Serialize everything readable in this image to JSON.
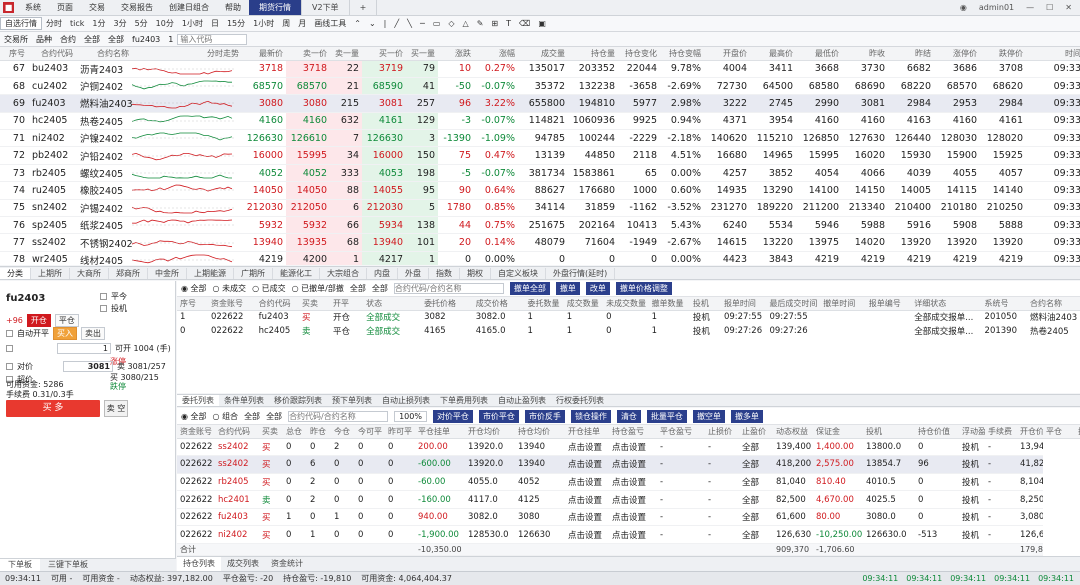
{
  "titlebar": {
    "menus": [
      "系统",
      "页面",
      "交易",
      "交易报告",
      "创建日组合",
      "帮助"
    ],
    "tabs": [
      "期货行情",
      "V2下单"
    ],
    "active_tab": "期货行情",
    "user": "admin01",
    "add_tab": "+"
  },
  "toolbar": {
    "items": [
      "自选行情",
      "分时",
      "tick",
      "1分",
      "3分",
      "5分",
      "10分",
      "1小时",
      "日",
      "15分",
      "1小时",
      "周",
      "月",
      "画线工具"
    ],
    "tools": [
      "⌃",
      "⌄",
      "|",
      "╱",
      "╲",
      "─",
      "▭",
      "◇",
      "△",
      "✎",
      "⊞",
      "T",
      "⌫",
      "▣"
    ]
  },
  "filterbar": {
    "items": [
      "交易所",
      "品种",
      "合约",
      "全部",
      "全部",
      "fu2403"
    ],
    "pager": "1",
    "search_placeholder": "输入代码"
  },
  "quotes": {
    "headers": [
      "序号",
      "合约代码",
      "合约名称",
      "分时走势",
      "最新价",
      "卖一价",
      "卖一量",
      "买一价",
      "买一量",
      "涨跌",
      "涨幅",
      "成交量",
      "持仓量",
      "持仓变化",
      "持仓变幅",
      "开盘价",
      "最高价",
      "最低价",
      "昨收",
      "昨结",
      "涨停价",
      "跌停价",
      "时间"
    ],
    "rows": [
      {
        "no": "67",
        "code": "bu2403",
        "name": "沥青2403",
        "last": "3718",
        "ask": "3718",
        "askv": "22",
        "bid": "3719",
        "bidv": "79",
        "chg": "10",
        "pct": "0.27%",
        "vol": "135017",
        "oi": "203352",
        "oichg": "22044",
        "oipct": "9.78%",
        "c1": "4004",
        "c2": "3411",
        "c3": "3668",
        "c4": "3730",
        "c5": "6682",
        "c6": "3686",
        "c7": "3708",
        "time": "09:33",
        "dir": "up"
      },
      {
        "no": "68",
        "code": "cu2402",
        "name": "沪铜2402",
        "last": "68570",
        "ask": "68570",
        "askv": "21",
        "bid": "68590",
        "bidv": "41",
        "chg": "-50",
        "pct": "-0.07%",
        "vol": "35372",
        "oi": "132238",
        "oichg": "-3658",
        "oipct": "-2.69%",
        "c1": "72730",
        "c2": "64500",
        "c3": "68580",
        "c4": "68690",
        "c5": "68220",
        "c6": "68570",
        "c7": "68620",
        "time": "09:33",
        "dir": "dn"
      },
      {
        "no": "69",
        "code": "fu2403",
        "name": "燃料油2403",
        "last": "3080",
        "ask": "3080",
        "askv": "215",
        "bid": "3081",
        "bidv": "257",
        "chg": "96",
        "pct": "3.22%",
        "vol": "655800",
        "oi": "194810",
        "oichg": "5977",
        "oipct": "2.98%",
        "c1": "3222",
        "c2": "2745",
        "c3": "2990",
        "c4": "3081",
        "c5": "2984",
        "c6": "2953",
        "c7": "2984",
        "time": "09:33",
        "dir": "up"
      },
      {
        "no": "70",
        "code": "hc2405",
        "name": "热卷2405",
        "last": "4160",
        "ask": "4160",
        "askv": "632",
        "bid": "4161",
        "bidv": "129",
        "chg": "-3",
        "pct": "-0.07%",
        "vol": "114821",
        "oi": "1060936",
        "oichg": "9925",
        "oipct": "0.94%",
        "c1": "4371",
        "c2": "3954",
        "c3": "4160",
        "c4": "4160",
        "c5": "4163",
        "c6": "4160",
        "c7": "4161",
        "time": "09:33",
        "dir": "dn"
      },
      {
        "no": "71",
        "code": "ni2402",
        "name": "沪镍2402",
        "last": "126630",
        "ask": "126610",
        "askv": "7",
        "bid": "126630",
        "bidv": "3",
        "chg": "-1390",
        "pct": "-1.09%",
        "vol": "94785",
        "oi": "100244",
        "oichg": "-2229",
        "oipct": "-2.18%",
        "c1": "140620",
        "c2": "115210",
        "c3": "126850",
        "c4": "127630",
        "c5": "126440",
        "c6": "128030",
        "c7": "128020",
        "time": "09:33",
        "dir": "dn"
      },
      {
        "no": "72",
        "code": "pb2402",
        "name": "沪铅2402",
        "last": "16000",
        "ask": "15995",
        "askv": "34",
        "bid": "16000",
        "bidv": "150",
        "chg": "75",
        "pct": "0.47%",
        "vol": "13139",
        "oi": "44850",
        "oichg": "2118",
        "oipct": "4.51%",
        "c1": "16680",
        "c2": "14965",
        "c3": "15995",
        "c4": "16020",
        "c5": "15930",
        "c6": "15900",
        "c7": "15925",
        "time": "09:33",
        "dir": "up"
      },
      {
        "no": "73",
        "code": "rb2405",
        "name": "螺纹2405",
        "last": "4052",
        "ask": "4052",
        "askv": "333",
        "bid": "4053",
        "bidv": "198",
        "chg": "-5",
        "pct": "-0.07%",
        "vol": "381734",
        "oi": "1583861",
        "oichg": "65",
        "oipct": "0.00%",
        "c1": "4257",
        "c2": "3852",
        "c3": "4054",
        "c4": "4066",
        "c5": "4039",
        "c6": "4055",
        "c7": "4057",
        "time": "09:33",
        "dir": "dn"
      },
      {
        "no": "74",
        "code": "ru2405",
        "name": "橡胶2405",
        "last": "14050",
        "ask": "14050",
        "askv": "88",
        "bid": "14055",
        "bidv": "95",
        "chg": "90",
        "pct": "0.64%",
        "vol": "88627",
        "oi": "176680",
        "oichg": "1000",
        "oipct": "0.60%",
        "c1": "14935",
        "c2": "13290",
        "c3": "14100",
        "c4": "14150",
        "c5": "14005",
        "c6": "14115",
        "c7": "14140",
        "time": "09:33",
        "dir": "up"
      },
      {
        "no": "75",
        "code": "sn2402",
        "name": "沪锡2402",
        "last": "212030",
        "ask": "212050",
        "askv": "6",
        "bid": "212030",
        "bidv": "5",
        "chg": "1780",
        "pct": "0.85%",
        "vol": "34114",
        "oi": "31859",
        "oichg": "-1162",
        "oipct": "-3.52%",
        "c1": "231270",
        "c2": "189220",
        "c3": "211200",
        "c4": "213340",
        "c5": "210400",
        "c6": "210180",
        "c7": "210250",
        "time": "09:33",
        "dir": "up"
      },
      {
        "no": "76",
        "code": "sp2405",
        "name": "纸浆2405",
        "last": "5932",
        "ask": "5932",
        "askv": "66",
        "bid": "5934",
        "bidv": "138",
        "chg": "44",
        "pct": "0.75%",
        "vol": "251675",
        "oi": "202164",
        "oichg": "10413",
        "oipct": "5.43%",
        "c1": "6240",
        "c2": "5534",
        "c3": "5946",
        "c4": "5988",
        "c5": "5916",
        "c6": "5908",
        "c7": "5888",
        "time": "09:33",
        "dir": "up"
      },
      {
        "no": "77",
        "code": "ss2402",
        "name": "不锈钢2402",
        "last": "13940",
        "ask": "13935",
        "askv": "68",
        "bid": "13940",
        "bidv": "101",
        "chg": "20",
        "pct": "0.14%",
        "vol": "48079",
        "oi": "71604",
        "oichg": "-1949",
        "oipct": "-2.67%",
        "c1": "14615",
        "c2": "13220",
        "c3": "13975",
        "c4": "14020",
        "c5": "13920",
        "c6": "13920",
        "c7": "13920",
        "time": "09:33",
        "dir": "up"
      },
      {
        "no": "78",
        "code": "wr2405",
        "name": "线材2405",
        "last": "4219",
        "ask": "4200",
        "askv": "1",
        "bid": "4217",
        "bidv": "1",
        "chg": "0",
        "pct": "0.00%",
        "vol": "0",
        "oi": "0",
        "oichg": "0",
        "oipct": "0.00%",
        "c1": "4423",
        "c2": "3843",
        "c3": "4219",
        "c4": "4219",
        "c5": "4219",
        "c6": "4219",
        "c7": "4219",
        "time": "09:33",
        "dir": "flat"
      }
    ]
  },
  "midtabs": [
    "分类",
    "上期所",
    "大商所",
    "郑商所",
    "中金所",
    "上期能源",
    "广期所",
    "能源化工",
    "大宗组合",
    "内盘",
    "外盘",
    "指数",
    "期权",
    "自定义板块",
    "外盘行情(延时)"
  ],
  "order": {
    "symbol": "fu2403",
    "price_change": "+96",
    "open_label": "开仓",
    "close_label": "平仓",
    "close_today": "平今",
    "auto_label": "自动开平",
    "hedge_label": "投机",
    "buy_label": "买入",
    "sell_label": "卖出",
    "qty": "1",
    "price": "3081",
    "limit_up": "涨停",
    "limit_dn": "跌停",
    "ask_info": "卖 3081/257",
    "bid_info": "买 3080/215",
    "max_open": "可开 1004 (手)",
    "available": "可用资金: 5286",
    "fee": "手续费 0.31/0.3手",
    "buy_button": "买 多",
    "sell_button": "卖 空",
    "chk1": "对价",
    "chk2": "超价",
    "chk3": "市价"
  },
  "bottomtabs": [
    "下单板",
    "三键下单板"
  ],
  "entrust": {
    "filters": [
      "全部",
      "未成交",
      "已成交",
      "已撤单/部撤",
      "全部",
      "全部"
    ],
    "search_placeholder": "合约代码/合约名称",
    "buttons": [
      "撤单全部",
      "撤单",
      "改单",
      "撤单价格调整"
    ],
    "headers": [
      "序号",
      "资金账号",
      "合约代码",
      "买卖",
      "开平",
      "状态",
      "委托价格",
      "成交价格",
      "委托数量",
      "成交数量",
      "未成交数量",
      "撤单数量",
      "投机",
      "报单时间",
      "最后成交时间",
      "撤单时间",
      "报单编号",
      "详细状态",
      "系统号",
      "合约名称"
    ],
    "rows": [
      {
        "no": "1",
        "acct": "022622",
        "code": "fu2403",
        "bs": "买",
        "oc": "开仓",
        "st": "全部成交",
        "price": "3082",
        "fprice": "3082.0",
        "qty": "1",
        "fqty": "1",
        "unf": "0",
        "cancel": "1",
        "tp": "0",
        "spec": "投机",
        "time": "09:27:55",
        "ftime": "09:27:55",
        "ctime": "",
        "ref": "",
        "detail": "全部成交报单...",
        "sys": "201050",
        "name": "燃料油2403"
      },
      {
        "no": "0",
        "acct": "022622",
        "code": "hc2405",
        "bs": "卖",
        "oc": "平仓",
        "st": "全部成交",
        "price": "4165",
        "fprice": "4165.0",
        "qty": "1",
        "fqty": "1",
        "unf": "0",
        "cancel": "1",
        "tp": "0",
        "spec": "投机",
        "time": "09:27:26",
        "ftime": "09:27:26",
        "ctime": "",
        "ref": "",
        "detail": "全部成交报单...",
        "sys": "201390",
        "name": "热卷2405"
      }
    ]
  },
  "subtabs": [
    "委托列表",
    "条件单列表",
    "移价跟踪列表",
    "预下单列表",
    "自动止损列表",
    "下单费用列表",
    "自动止盈列表",
    "行权委托列表"
  ],
  "positions": {
    "filters": [
      "全部",
      "组合",
      "全部",
      "全部"
    ],
    "search_placeholder": "合约代码/合约名称",
    "zoom": "100%",
    "buttons": [
      "对价平仓",
      "市价平仓",
      "市价反手",
      "锁仓操作",
      "清仓",
      "批量平仓",
      "撤空单",
      "撤多单"
    ],
    "headers": [
      "资金账号",
      "合约代码",
      "买卖",
      "总仓",
      "昨仓",
      "今仓",
      "今可平",
      "昨可平",
      "平仓挂单",
      "开仓均价",
      "持仓均价",
      "开仓挂单",
      "持仓盈亏",
      "平仓盈亏",
      "止损价",
      "止盈价",
      "动态权益",
      "保证金",
      "投机",
      "持仓价值",
      "浮动盈亏",
      "手续费",
      "开仓价差",
      "平仓",
      "投保",
      "合约名称",
      "手数"
    ],
    "rows": [
      {
        "acct": "022622",
        "code": "ss2402",
        "bs": "买",
        "total": "0",
        "yd": "0",
        "td": "2",
        "ctd": "0",
        "cyd": "0",
        "pend": "200.00",
        "oavg": "13920.0",
        "pavg": "13940",
        "opend": "点击设置",
        "pnl": "点击设置",
        "cpnl": "-",
        "sl": "-",
        "tp": "全部",
        "eq": "139,400",
        "mg": "1,400.00",
        "spec": "13800.0",
        "val": "0",
        "float": "投机",
        "fee": "-",
        "sp": "13,940.00"
      },
      {
        "acct": "022622",
        "code": "ss2402",
        "bs": "买",
        "total": "0",
        "yd": "6",
        "td": "0",
        "ctd": "0",
        "cyd": "0",
        "pend": "-600.00",
        "oavg": "13920.0",
        "pavg": "13940",
        "opend": "点击设置",
        "pnl": "点击设置",
        "cpnl": "-",
        "sl": "-",
        "tp": "全部",
        "eq": "418,200",
        "mg": "2,575.00",
        "spec": "13854.7",
        "val": "96",
        "float": "投机",
        "fee": "-",
        "sp": "41,820.00"
      },
      {
        "acct": "022622",
        "code": "rb2405",
        "bs": "买",
        "total": "0",
        "yd": "2",
        "td": "0",
        "ctd": "0",
        "cyd": "0",
        "pend": "-60.00",
        "oavg": "4055.0",
        "pavg": "4052",
        "opend": "点击设置",
        "pnl": "点击设置",
        "cpnl": "-",
        "sl": "-",
        "tp": "全部",
        "eq": "81,040",
        "mg": "810.40",
        "spec": "4010.5",
        "val": "0",
        "float": "投机",
        "fee": "-",
        "sp": "8,104.00"
      },
      {
        "acct": "022622",
        "code": "hc2401",
        "bs": "卖",
        "total": "0",
        "yd": "2",
        "td": "0",
        "ctd": "0",
        "cyd": "0",
        "pend": "-160.00",
        "oavg": "4117.0",
        "pavg": "4125",
        "opend": "点击设置",
        "pnl": "点击设置",
        "cpnl": "-",
        "sl": "-",
        "tp": "全部",
        "eq": "82,500",
        "mg": "4,670.00",
        "spec": "4025.5",
        "val": "0",
        "float": "投机",
        "fee": "-",
        "sp": "8,250.00"
      },
      {
        "acct": "022622",
        "code": "fu2403",
        "bs": "买",
        "total": "1",
        "yd": "0",
        "td": "1",
        "ctd": "0",
        "cyd": "0",
        "pend": "940.00",
        "oavg": "3082.0",
        "pavg": "3080",
        "opend": "点击设置",
        "pnl": "点击设置",
        "cpnl": "-",
        "sl": "-",
        "tp": "全部",
        "eq": "61,600",
        "mg": "80.00",
        "spec": "3080.0",
        "val": "0",
        "float": "投机",
        "fee": "-",
        "sp": "3,080.00"
      },
      {
        "acct": "022622",
        "code": "ni2402",
        "bs": "买",
        "total": "0",
        "yd": "1",
        "td": "0",
        "ctd": "0",
        "cyd": "0",
        "pend": "-1,900.00",
        "oavg": "128530.0",
        "pavg": "126630",
        "opend": "点击设置",
        "pnl": "点击设置",
        "cpnl": "-",
        "sl": "-",
        "tp": "全部",
        "eq": "126,630",
        "mg": "-10,250.00",
        "spec": "126630.0",
        "val": "-513",
        "float": "投机",
        "fee": "-",
        "sp": "126,630.00"
      }
    ],
    "total_label": "合计",
    "total_pend": "-10,350.00",
    "total_eq": "909,370",
    "total_mg": "-1,706.60",
    "total_sp": "179,824.00"
  },
  "postabs": [
    "持仓列表",
    "成交列表",
    "资金统计"
  ],
  "status": {
    "items": [
      "09:34:11",
      "可用 -",
      "可用资金 -",
      "动态权益: 397,182.00",
      "平仓盈亏: -20",
      "持仓盈亏: -19,810",
      "可用资金: 4,064,404.37"
    ],
    "right": [
      "09:34:11",
      "09:34:11",
      "09:34:11",
      "09:34:11",
      "09:34:11"
    ]
  }
}
